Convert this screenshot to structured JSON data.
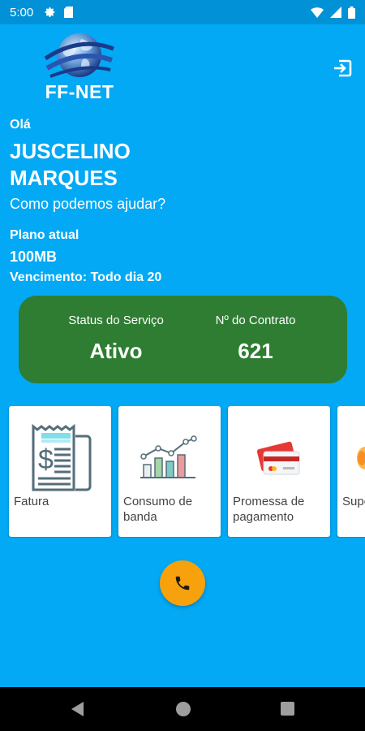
{
  "status_bar": {
    "time": "5:00"
  },
  "brand": {
    "name": "FF-NET"
  },
  "greeting": "Olá",
  "user": {
    "name": "JUSCELINO MARQUES"
  },
  "help_text": "Como podemos ajudar?",
  "plan": {
    "label": "Plano atual",
    "value": "100MB",
    "due": "Vencimento: Todo dia 20"
  },
  "service_card": {
    "status_label": "Status do Serviço",
    "status_value": "Ativo",
    "contract_label": "Nº do Contrato",
    "contract_value": "621",
    "color": "#2e7d32"
  },
  "menu": [
    {
      "label": "Fatura",
      "icon": "invoice-icon"
    },
    {
      "label": "Consumo de banda",
      "icon": "bar-chart-icon"
    },
    {
      "label": "Promessa de pagamento",
      "icon": "credit-card-icon"
    },
    {
      "label": "Suporte",
      "icon": "support-icon"
    }
  ],
  "colors": {
    "background": "#03a9f4",
    "call_button": "#f7a10d"
  }
}
